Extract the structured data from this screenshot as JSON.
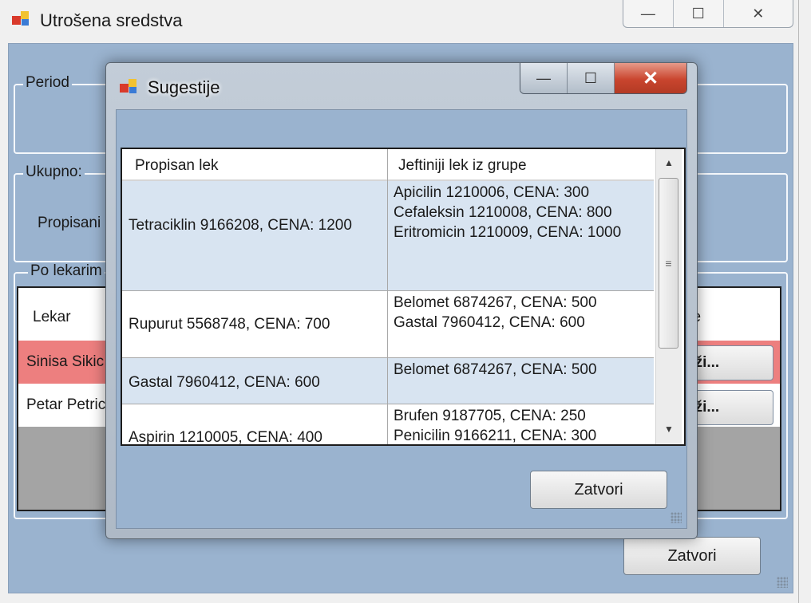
{
  "main_window": {
    "title": "Utrošena sredstva",
    "caption": {
      "minimize": "—",
      "maximize": "☐",
      "close": "✕"
    },
    "groups": {
      "period": "Period",
      "ukupno": "Ukupno:",
      "po_lekarima": "Po lekarim"
    },
    "ukupno_label": "Propisani",
    "grid": {
      "columns": [
        "Lekar",
        "ije"
      ],
      "rows": [
        {
          "lekar": "Sinisa Sikic",
          "action": "aži...",
          "highlight": "#ed7f7f"
        },
        {
          "lekar": "Petar Petric",
          "action": "aži..."
        }
      ]
    },
    "close_button": "Zatvori"
  },
  "dialog": {
    "title": "Sugestije",
    "caption": {
      "minimize": "—",
      "maximize": "☐",
      "close": "✕"
    },
    "grid": {
      "columns": [
        "Propisan lek",
        "Jeftiniji lek iz grupe"
      ],
      "rows": [
        {
          "propisan": "Tetraciklin 9166208, CENA: 1200",
          "jeftiniji": [
            "Apicilin  1210006, CENA: 300",
            "Cefaleksin  1210008, CENA: 800",
            "Eritromicin  1210009, CENA: 1000"
          ]
        },
        {
          "propisan": "Rupurut 5568748, CENA: 700",
          "jeftiniji": [
            "Belomet 6874267, CENA: 500",
            "Gastal 7960412, CENA: 600"
          ]
        },
        {
          "propisan": "Gastal 7960412, CENA: 600",
          "jeftiniji": [
            "Belomet 6874267, CENA: 500"
          ]
        },
        {
          "propisan": "Aspirin 1210005, CENA: 400",
          "jeftiniji": [
            "Brufen 9187705, CENA: 250",
            "Penicilin 9166211, CENA: 300"
          ]
        }
      ]
    },
    "close_button": "Zatvori"
  }
}
